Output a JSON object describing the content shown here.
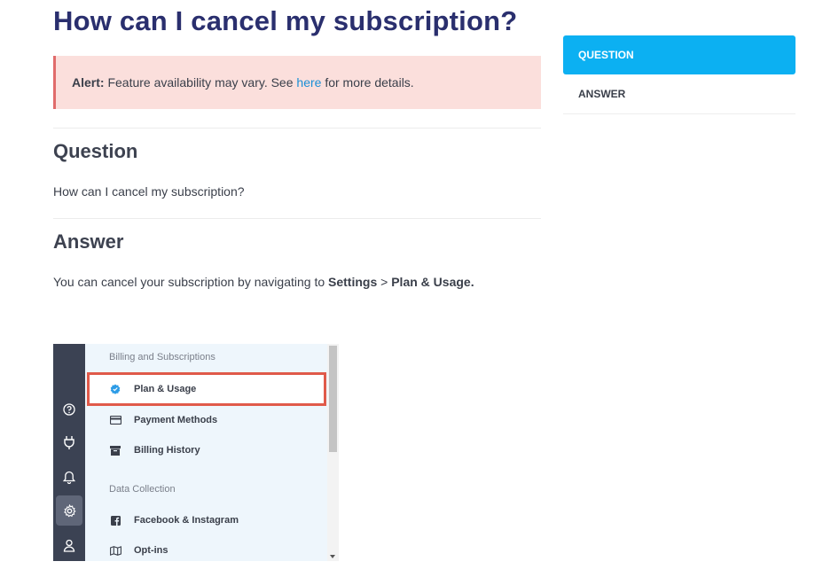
{
  "article": {
    "title": "How can I cancel my subscription?",
    "alert": {
      "label": "Alert:",
      "text_before": " Feature availability may vary. See ",
      "link": "here",
      "text_after": " for more details."
    },
    "question": {
      "heading": "Question",
      "text": "How can I cancel my subscription?"
    },
    "answer": {
      "heading": "Answer",
      "text_before": "You can cancel your subscription by navigating to ",
      "bold_1": "Settings",
      "separator": " > ",
      "bold_2": "Plan & Usage."
    }
  },
  "screenshot": {
    "rail_icons": [
      "help-circle-icon",
      "plug-icon",
      "bell-icon",
      "gear-icon",
      "user-icon"
    ],
    "groups": {
      "billing": "Billing and Subscriptions",
      "data": "Data Collection"
    },
    "items": {
      "plan": "Plan & Usage",
      "payment": "Payment Methods",
      "history": "Billing History",
      "facebook": "Facebook & Instagram",
      "optins": "Opt-ins"
    }
  },
  "toc": {
    "items": [
      {
        "label": "QUESTION",
        "active": true
      },
      {
        "label": "ANSWER",
        "active": false
      }
    ]
  },
  "colors": {
    "title": "#2a2f6e",
    "accent": "#0cb0f2",
    "alert_bg": "#fbdfdc",
    "alert_border": "#e06b6b",
    "link": "#1a8fd6",
    "highlight_border": "#e05a4a"
  }
}
